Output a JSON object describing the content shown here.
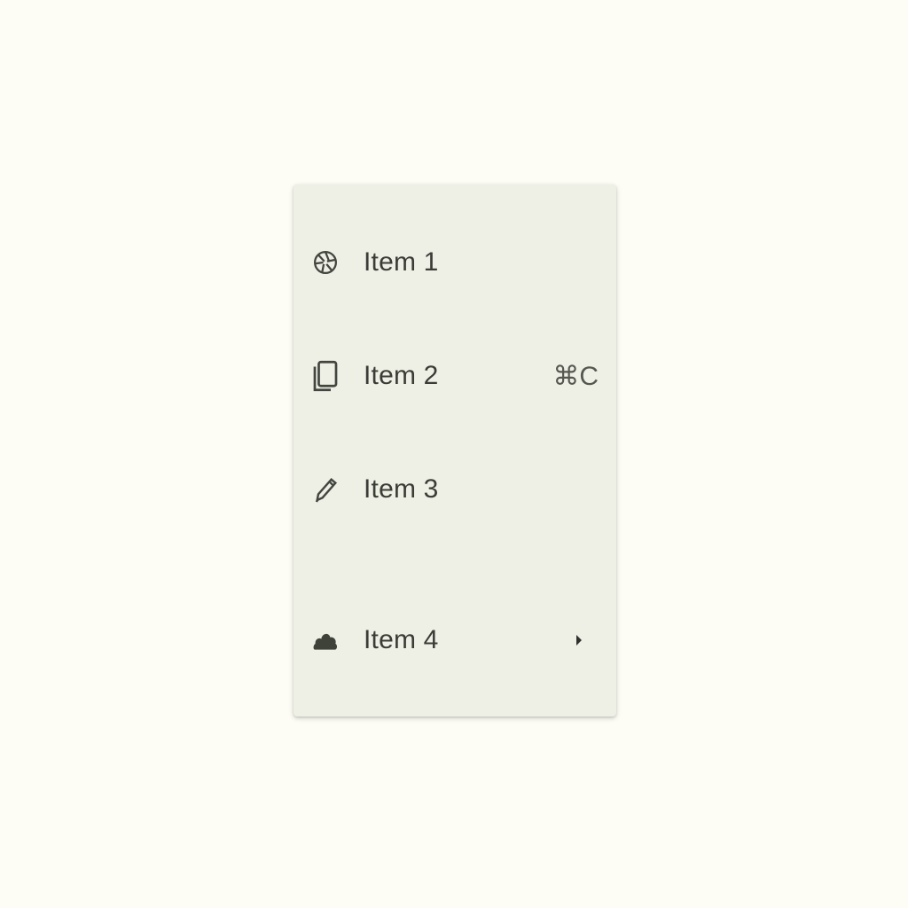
{
  "menu": {
    "items": [
      {
        "label": "Item 1",
        "icon": "aperture-icon",
        "trailing": ""
      },
      {
        "label": "Item 2",
        "icon": "tablet-icon",
        "trailing": "⌘C"
      },
      {
        "label": "Item 3",
        "icon": "pencil-icon",
        "trailing": ""
      },
      {
        "label": "Item 4",
        "icon": "cloud-icon",
        "trailing_icon": "chevron-right-icon"
      }
    ]
  },
  "colors": {
    "background": "#fdfdf5",
    "menu_surface": "#eef0e6",
    "text": "#3a3c36",
    "icon": "#43463f"
  }
}
